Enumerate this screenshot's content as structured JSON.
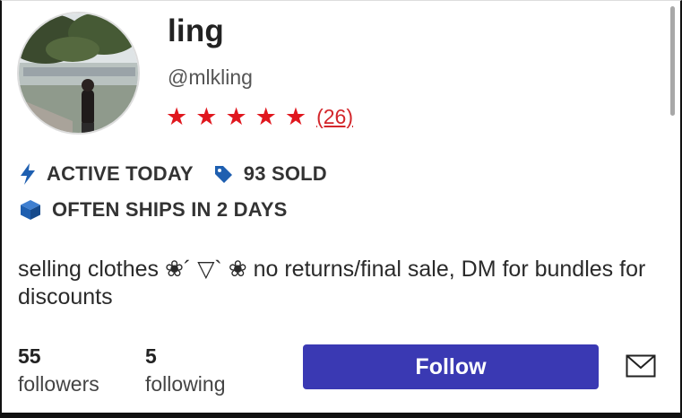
{
  "profile": {
    "name": "ling",
    "handle": "@mlkling",
    "rating": {
      "stars": 5,
      "count_label": "(26)"
    },
    "bio": "selling clothes ❀´ ▽` ❀  no returns/final sale, DM for bundles for discounts"
  },
  "badges": {
    "active": {
      "icon": "lightning-icon",
      "label": "ACTIVE TODAY"
    },
    "sold": {
      "icon": "tag-icon",
      "label": "93 SOLD"
    },
    "ships": {
      "icon": "box-icon",
      "label": "OFTEN SHIPS IN 2 DAYS"
    }
  },
  "stats": {
    "followers": {
      "count": "55",
      "label": "followers"
    },
    "following": {
      "count": "5",
      "label": "following"
    }
  },
  "actions": {
    "follow_label": "Follow",
    "message_icon": "mail-icon"
  },
  "colors": {
    "star": "#e0171e",
    "badge_icon": "#1e5fb0",
    "follow_button": "#3a39b3"
  }
}
